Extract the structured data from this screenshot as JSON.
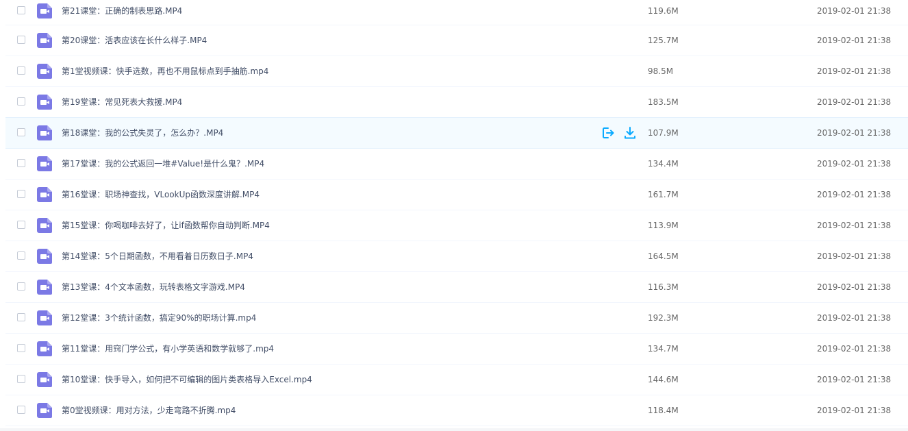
{
  "colors": {
    "icon_purple": "#7b79e5",
    "action_blue": "#09aaff",
    "hover_row_bg": "#f4fbff"
  },
  "icons": {
    "file_type": "video-file-icon",
    "share": "share-icon",
    "download": "download-icon"
  },
  "files": [
    {
      "name": "第21课堂：正确的制表思路.MP4",
      "size": "119.6M",
      "date": "2019-02-01 21:38"
    },
    {
      "name": "第20课堂：活表应该在长什么样子.MP4",
      "size": "125.7M",
      "date": "2019-02-01 21:38"
    },
    {
      "name": "第1堂视频课：快手选数，再也不用鼠标点到手抽筋.mp4",
      "size": "98.5M",
      "date": "2019-02-01 21:38"
    },
    {
      "name": "第19堂课：常见死表大救援.MP4",
      "size": "183.5M",
      "date": "2019-02-01 21:38"
    },
    {
      "name": "第18课堂：我的公式失灵了，怎么办？.MP4",
      "size": "107.9M",
      "date": "2019-02-01 21:38"
    },
    {
      "name": "第17堂课：我的公式返回一堆#Value!是什么鬼？.MP4",
      "size": "134.4M",
      "date": "2019-02-01 21:38"
    },
    {
      "name": "第16堂课：职场神查找，VLookUp函数深度讲解.MP4",
      "size": "161.7M",
      "date": "2019-02-01 21:38"
    },
    {
      "name": "第15堂课：你喝咖啡去好了，让if函数帮你自动判断.MP4",
      "size": "113.9M",
      "date": "2019-02-01 21:38"
    },
    {
      "name": "第14堂课：5个日期函数，不用看着日历数日子.MP4",
      "size": "164.5M",
      "date": "2019-02-01 21:38"
    },
    {
      "name": "第13堂课：4个文本函数，玩转表格文字游戏.MP4",
      "size": "116.3M",
      "date": "2019-02-01 21:38"
    },
    {
      "name": "第12堂课：3个统计函数，搞定90%的职场计算.mp4",
      "size": "192.3M",
      "date": "2019-02-01 21:38"
    },
    {
      "name": "第11堂课：用窍门学公式，有小学英语和数学就够了.mp4",
      "size": "134.7M",
      "date": "2019-02-01 21:38"
    },
    {
      "name": "第10堂课：快手导入，如何把不可编辑的图片类表格导入Excel.mp4",
      "size": "144.6M",
      "date": "2019-02-01 21:38"
    },
    {
      "name": "第0堂视频课：用对方法，少走弯路不折腾.mp4",
      "size": "118.4M",
      "date": "2019-02-01 21:38"
    }
  ]
}
